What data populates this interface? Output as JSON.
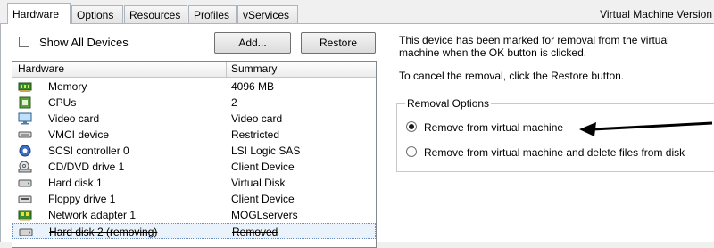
{
  "tabs": [
    "Hardware",
    "Options",
    "Resources",
    "Profiles",
    "vServices"
  ],
  "version_label": "Virtual Machine Version",
  "show_all_devices": {
    "label": "Show All Devices",
    "checked": false
  },
  "buttons": {
    "add": "Add...",
    "restore": "Restore"
  },
  "table": {
    "columns": [
      "Hardware",
      "Summary"
    ],
    "rows": [
      {
        "name": "Memory",
        "summary": "4096 MB",
        "icon": "memory-icon"
      },
      {
        "name": "CPUs",
        "summary": "2",
        "icon": "cpu-icon"
      },
      {
        "name": "Video card",
        "summary": "Video card",
        "icon": "monitor-icon"
      },
      {
        "name": "VMCI device",
        "summary": "Restricted",
        "icon": "vmci-device-icon"
      },
      {
        "name": "SCSI controller 0",
        "summary": "LSI Logic SAS",
        "icon": "scsi-controller-icon"
      },
      {
        "name": "CD/DVD drive 1",
        "summary": "Client Device",
        "icon": "cd-dvd-icon"
      },
      {
        "name": "Hard disk 1",
        "summary": "Virtual Disk",
        "icon": "hard-disk-icon"
      },
      {
        "name": "Floppy drive 1",
        "summary": "Client Device",
        "icon": "floppy-icon"
      },
      {
        "name": "Network adapter 1",
        "summary": "MOGLservers",
        "icon": "network-adapter-icon"
      },
      {
        "name": "Hard disk 2 (removing)",
        "summary": "Removed",
        "icon": "hard-disk-icon",
        "removing": true
      }
    ]
  },
  "info": {
    "line1": "This device has been marked for removal from the virtual",
    "line2": "machine when the OK button is clicked.",
    "line3": "To cancel the removal, click the Restore button."
  },
  "removal_options": {
    "title": "Removal Options",
    "options": [
      {
        "label": "Remove from virtual machine",
        "selected": true
      },
      {
        "label": "Remove from virtual machine and delete files from disk",
        "selected": false
      }
    ]
  },
  "colors": {
    "selection": "#eaf3fc",
    "accent": "#2060c0"
  }
}
